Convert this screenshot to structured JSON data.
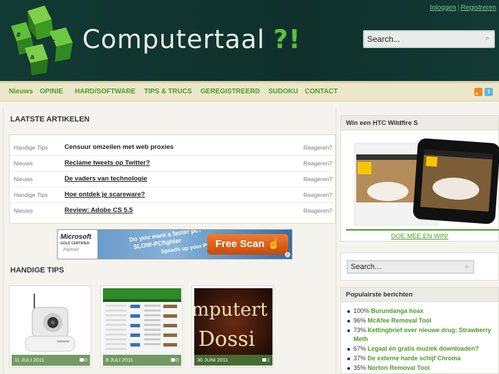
{
  "header": {
    "site_title": "Computertaal",
    "site_title_suffix": "?!",
    "auth": {
      "login": "Inloggen",
      "separator": "|",
      "register": "Registreren"
    },
    "search": {
      "placeholder": "Search..."
    },
    "colors": {
      "background": "#10352f",
      "accent": "#5cbf3e"
    }
  },
  "nav": {
    "items": [
      "Nieuws",
      "OPINIE",
      "HARD/SOFTWARE",
      "TIPS & TRUCS",
      "GEREGISTREERD",
      "SUDOKU",
      "CONTACT"
    ],
    "icons": [
      "rss-icon",
      "twitter-icon"
    ],
    "color": "#4e9a2a"
  },
  "main": {
    "latest_title": "LAATSTE ARTIKELEN",
    "articles": [
      {
        "category": "Handige Tips",
        "title": "Censuur omzeilen met web proxies",
        "react": "Reageren?"
      },
      {
        "category": "Nieuws",
        "title": "Reclame tweets op Twitter?",
        "react": "Reageren?"
      },
      {
        "category": "Nieuws",
        "title": "De vaders van technologie",
        "react": "Reageren?"
      },
      {
        "category": "Handige Tips",
        "title": "Hoe ontdek je scareware?",
        "react": "Reageren?"
      },
      {
        "category": "Nieuws",
        "title": "Review: Adobe CS 5.5",
        "react": "Reageren?"
      }
    ],
    "ad": {
      "brand": "Microsoft",
      "certification": "GOLD CERTIFIED",
      "partner": "Partner",
      "line1": "Do you want a faster pc?",
      "line2": "SLOW-PCfighter",
      "line3": "Speeds up your PC!",
      "button": "Free Scan"
    },
    "tips_title": "HANDIGE TIPS",
    "cards": [
      {
        "date": "11 JULI 2011",
        "comments": "0"
      },
      {
        "date": "8 JULI 2011",
        "comments": "0"
      },
      {
        "date": "30 JUNI 2011",
        "comments": "1"
      }
    ]
  },
  "sidebar": {
    "promo": {
      "title": "Win een HTC Wildfire S",
      "link": "DOE MEE EN WIN!"
    },
    "search": {
      "placeholder": "Search..."
    },
    "popular": {
      "title": "Populairste berichten",
      "items": [
        {
          "pct": "100%",
          "label": "Burundanga hoax"
        },
        {
          "pct": "96%",
          "label": "McAfee Removal Tool"
        },
        {
          "pct": "73%",
          "label": "Kettingbrief over nieuwe drug: Strawberry Meth"
        },
        {
          "pct": "67%",
          "label": "Legaal én gratis muziek downloaden?"
        },
        {
          "pct": "37%",
          "label": "De externe harde schijf Chroma"
        },
        {
          "pct": "35%",
          "label": "Norton Removal Tool"
        }
      ]
    }
  }
}
